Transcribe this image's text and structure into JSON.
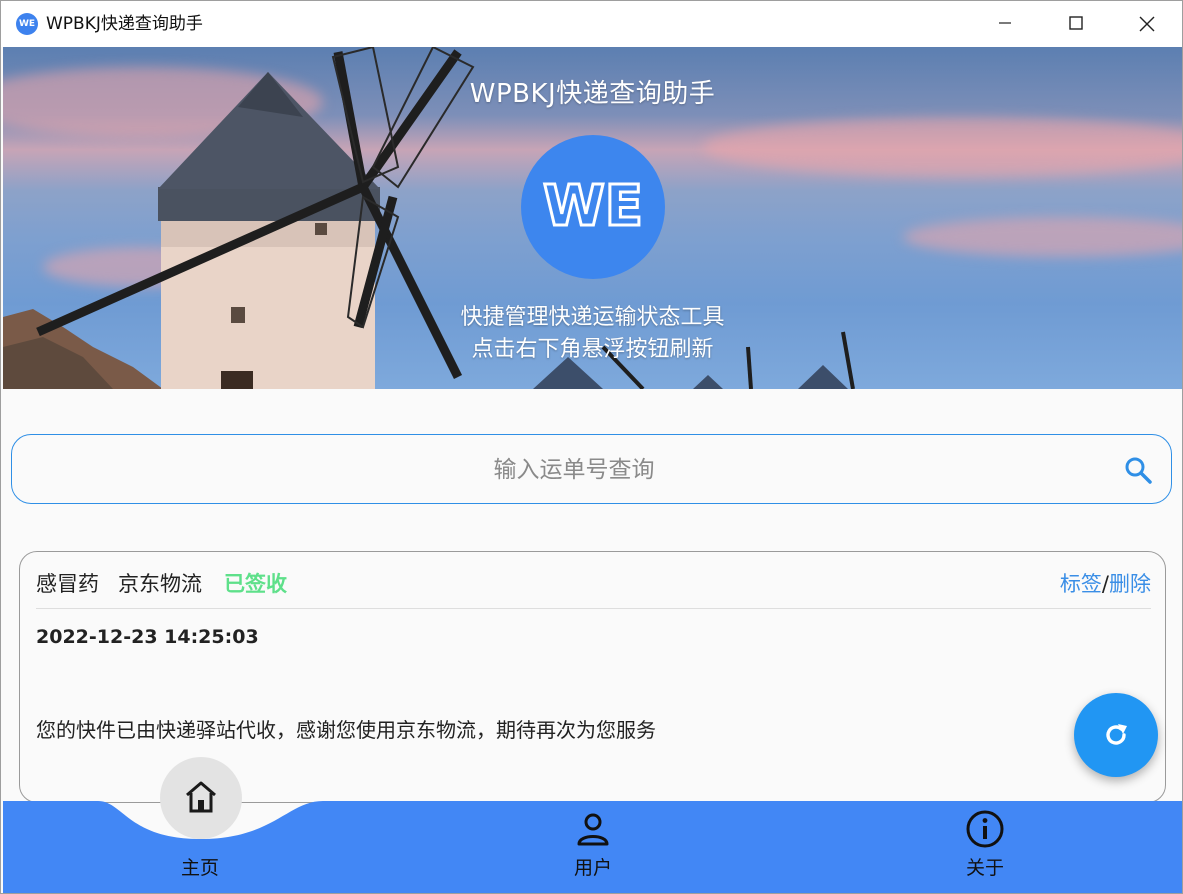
{
  "window": {
    "title": "WPBKJ快递查询助手",
    "controls": {
      "minimize": "—",
      "maximize": "☐",
      "close": "✕"
    }
  },
  "hero": {
    "title": "WPBKJ快递查询助手",
    "logo_text": "WE",
    "subtitle_line1": "快捷管理快递运输状态工具",
    "subtitle_line2": "点击右下角悬浮按钮刷新"
  },
  "search": {
    "placeholder": "输入运单号查询",
    "value": ""
  },
  "package": {
    "name": "感冒药",
    "carrier": "京东物流",
    "status": "已签收",
    "tag_link": "标签",
    "separator": "/",
    "delete_link": "删除",
    "timestamp": "2022-12-23 14:25:03",
    "message": "您的快件已由快递驿站代收，感谢您使用京东物流，期待再次为您服务"
  },
  "nav": {
    "items": [
      {
        "label": "主页",
        "icon": "home-icon",
        "active": true
      },
      {
        "label": "用户",
        "icon": "user-icon",
        "active": false
      },
      {
        "label": "关于",
        "icon": "info-icon",
        "active": false
      }
    ]
  },
  "colors": {
    "accent": "#2196F3",
    "nav_background": "#4287F5",
    "status_green": "#5EE08A",
    "link_blue": "#3A8EE6"
  }
}
